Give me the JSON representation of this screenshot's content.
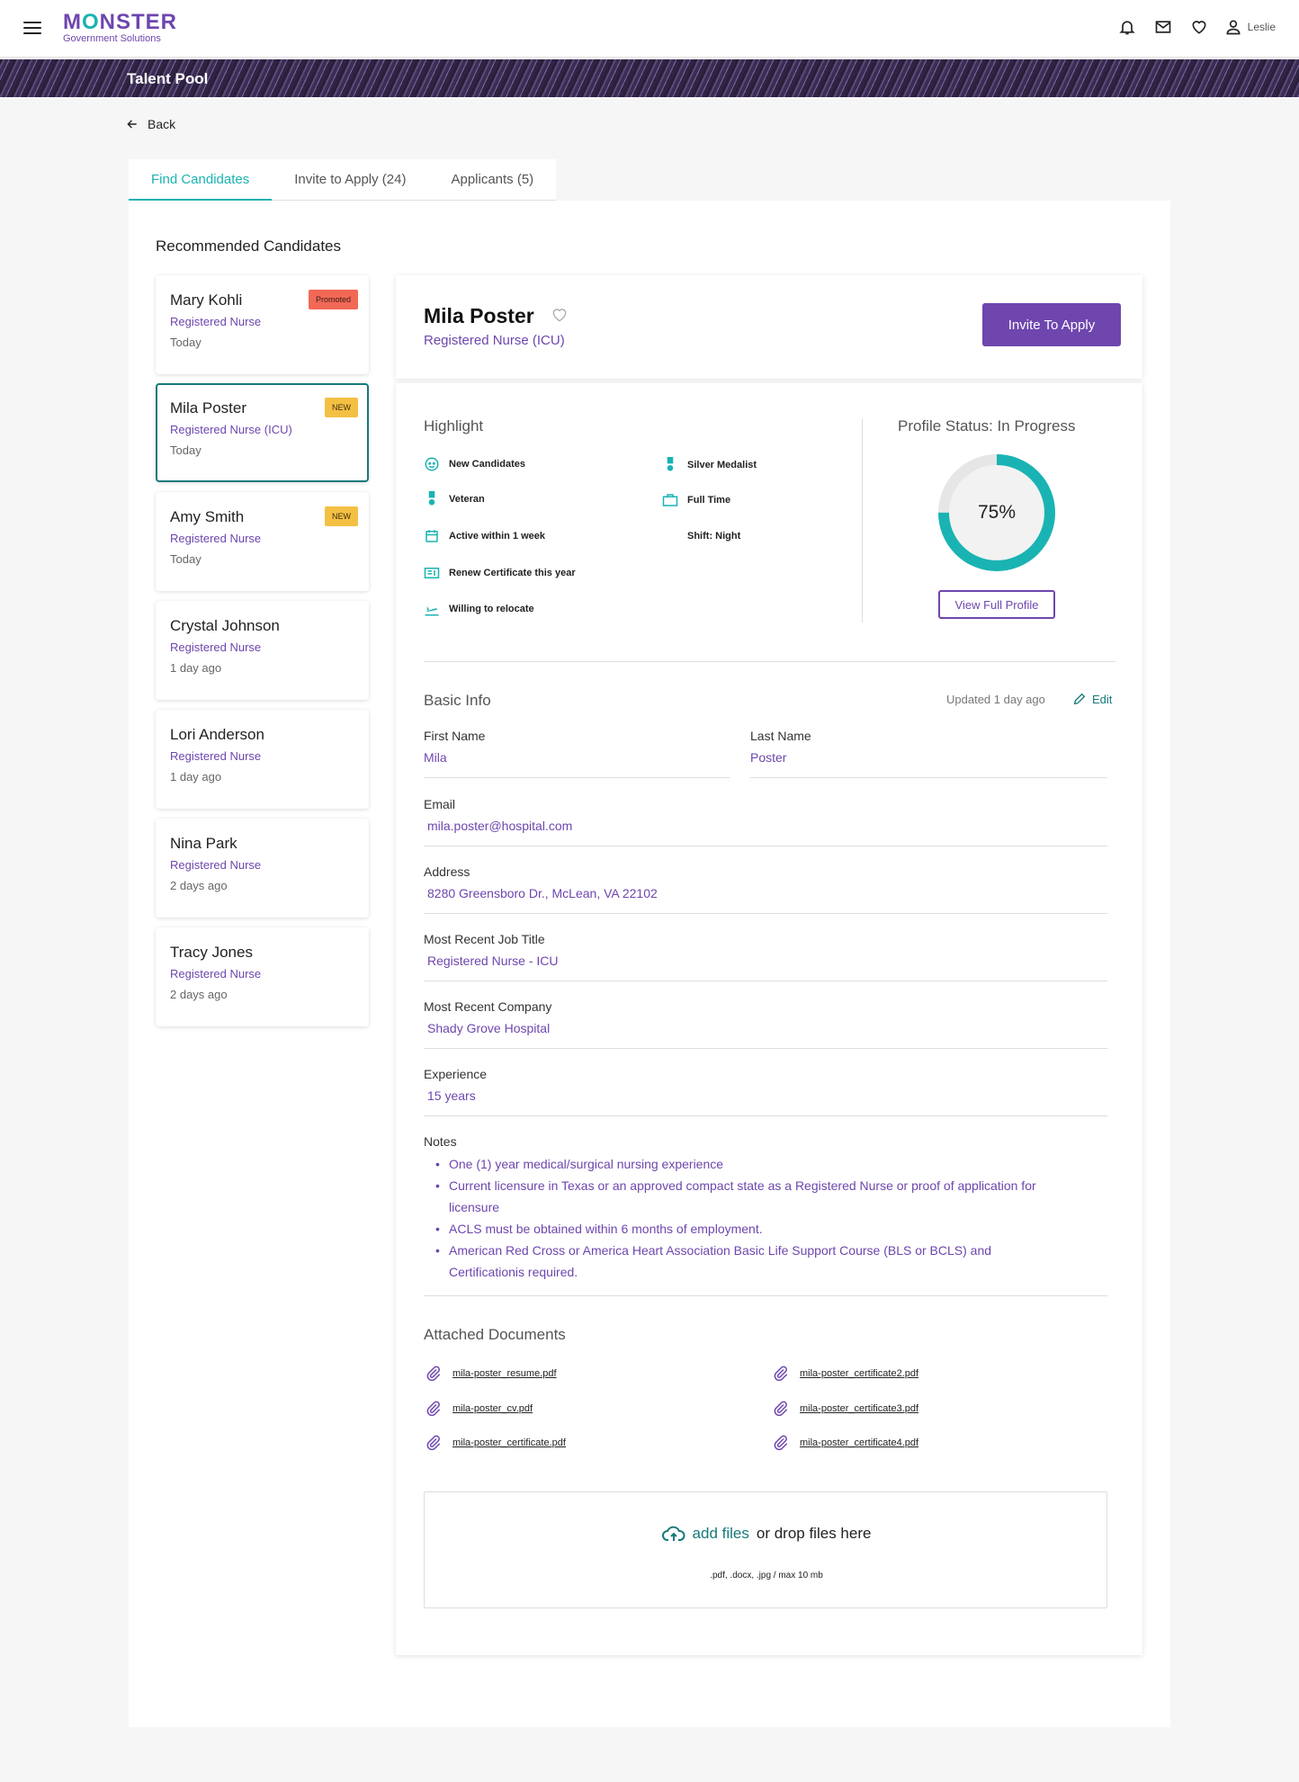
{
  "brand": {
    "name_pre": "M",
    "name_o": "O",
    "name_post": "NSTER",
    "subtitle": "Government Solutions"
  },
  "user": {
    "name": "Leslie"
  },
  "banner": {
    "title": "Talent Pool"
  },
  "nav": {
    "back_label": "Back"
  },
  "tabs": [
    {
      "label": "Find Candidates",
      "active": true
    },
    {
      "label": "Invite to Apply (24)",
      "active": false
    },
    {
      "label": "Applicants (5)",
      "active": false
    }
  ],
  "recommended": {
    "title": "Recommended Candidates",
    "candidates": [
      {
        "name": "Mary Kohli",
        "role": "Registered Nurse",
        "time": "Today",
        "badge": "Promoted"
      },
      {
        "name": "Mila Poster",
        "role": "Registered Nurse (ICU)",
        "time": "Today",
        "badge": "NEW",
        "selected": true
      },
      {
        "name": "Amy Smith",
        "role": "Registered Nurse",
        "time": "Today",
        "badge": "NEW"
      },
      {
        "name": "Crystal Johnson",
        "role": "Registered Nurse",
        "time": "1 day ago"
      },
      {
        "name": "Lori Anderson",
        "role": "Registered Nurse",
        "time": "1 day ago"
      },
      {
        "name": "Nina Park",
        "role": "Registered Nurse",
        "time": "2 days ago"
      },
      {
        "name": "Tracy Jones",
        "role": "Registered Nurse",
        "time": "2 days ago"
      }
    ]
  },
  "profile": {
    "name": "Mila Poster",
    "role": "Registered Nurse (ICU)",
    "invite_label": "Invite To Apply",
    "highlight_title": "Highlight",
    "highlights_left": [
      {
        "icon": "face-icon",
        "label": "New Candidates"
      },
      {
        "icon": "medal-icon",
        "label": "Veteran"
      },
      {
        "icon": "calendar-icon",
        "label": "Active within 1 week"
      },
      {
        "icon": "certificate-icon",
        "label": "Renew Certificate this year"
      },
      {
        "icon": "plane-icon",
        "label": "Willing to relocate"
      }
    ],
    "highlights_right": [
      {
        "icon": "medal-icon",
        "label": "Silver Medalist"
      },
      {
        "icon": "briefcase-icon",
        "label": "Full Time"
      },
      {
        "icon": "moon-icon",
        "label": "Shift: Night"
      }
    ],
    "status_title": "Profile Status: In Progress",
    "status_percent": 75,
    "status_label": "75%",
    "view_profile_label": "View Full Profile",
    "basic_info": {
      "title": "Basic Info",
      "updated": "Updated 1 day ago",
      "edit_label": "Edit",
      "first_name_label": "First Name",
      "first_name": "Mila",
      "last_name_label": "Last Name",
      "last_name": "Poster",
      "email_label": "Email",
      "email": "mila.poster@hospital.com",
      "address_label": "Address",
      "address": "8280 Greensboro Dr., McLean, VA 22102",
      "job_title_label": "Most Recent Job Title",
      "job_title": "Registered Nurse - ICU",
      "company_label": "Most Recent Company",
      "company": "Shady Grove Hospital",
      "experience_label": "Experience",
      "experience": "15 years",
      "notes_label": "Notes",
      "notes": [
        "One (1) year medical/surgical nursing experience",
        "Current licensure in Texas or an approved compact state as a Registered Nurse or proof of application for licensure",
        "ACLS must be obtained within 6 months of employment.",
        "American Red Cross or America Heart Association Basic Life Support Course (BLS or BCLS) and Certificationis required."
      ]
    },
    "documents": {
      "title": "Attached Documents",
      "left": [
        "mila-poster_resume.pdf",
        "mila-poster_cv.pdf",
        "mila-poster_certificate.pdf"
      ],
      "right": [
        "mila-poster_certificate2.pdf",
        "mila-poster_certificate3.pdf",
        "mila-poster_certificate4.pdf"
      ]
    },
    "upload": {
      "add_label": "add files",
      "rest_label": "or drop files here",
      "hint": ".pdf, .docx, .jpg / max 10 mb"
    }
  },
  "colors": {
    "brand_purple": "#6e46ae",
    "teal": "#1ab3b3",
    "promoted": "#f26857",
    "new": "#f4c044"
  }
}
